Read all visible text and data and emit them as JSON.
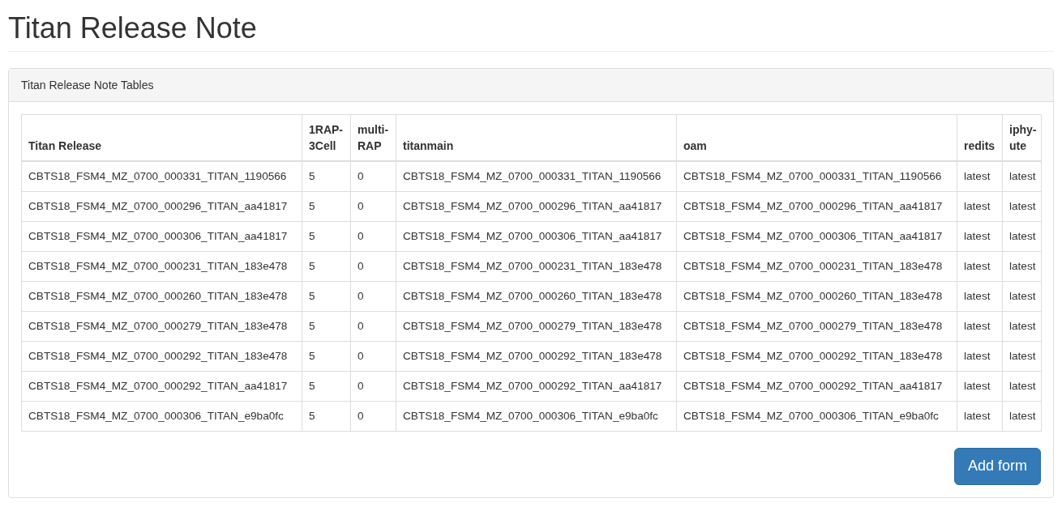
{
  "page_title": "Titan Release Note",
  "panel": {
    "heading": "Titan Release Note Tables",
    "table": {
      "columns": [
        "Titan Release",
        "1RAP-3Cell",
        "multi-RAP",
        "titanmain",
        "oam",
        "redits",
        "iphy-ute"
      ],
      "rows": [
        [
          "CBTS18_FSM4_MZ_0700_000331_TITAN_1190566",
          "5",
          "0",
          "CBTS18_FSM4_MZ_0700_000331_TITAN_1190566",
          "CBTS18_FSM4_MZ_0700_000331_TITAN_1190566",
          "latest",
          "latest"
        ],
        [
          "CBTS18_FSM4_MZ_0700_000296_TITAN_aa41817",
          "5",
          "0",
          "CBTS18_FSM4_MZ_0700_000296_TITAN_aa41817",
          "CBTS18_FSM4_MZ_0700_000296_TITAN_aa41817",
          "latest",
          "latest"
        ],
        [
          "CBTS18_FSM4_MZ_0700_000306_TITAN_aa41817",
          "5",
          "0",
          "CBTS18_FSM4_MZ_0700_000306_TITAN_aa41817",
          "CBTS18_FSM4_MZ_0700_000306_TITAN_aa41817",
          "latest",
          "latest"
        ],
        [
          "CBTS18_FSM4_MZ_0700_000231_TITAN_183e478",
          "5",
          "0",
          "CBTS18_FSM4_MZ_0700_000231_TITAN_183e478",
          "CBTS18_FSM4_MZ_0700_000231_TITAN_183e478",
          "latest",
          "latest"
        ],
        [
          "CBTS18_FSM4_MZ_0700_000260_TITAN_183e478",
          "5",
          "0",
          "CBTS18_FSM4_MZ_0700_000260_TITAN_183e478",
          "CBTS18_FSM4_MZ_0700_000260_TITAN_183e478",
          "latest",
          "latest"
        ],
        [
          "CBTS18_FSM4_MZ_0700_000279_TITAN_183e478",
          "5",
          "0",
          "CBTS18_FSM4_MZ_0700_000279_TITAN_183e478",
          "CBTS18_FSM4_MZ_0700_000279_TITAN_183e478",
          "latest",
          "latest"
        ],
        [
          "CBTS18_FSM4_MZ_0700_000292_TITAN_183e478",
          "5",
          "0",
          "CBTS18_FSM4_MZ_0700_000292_TITAN_183e478",
          "CBTS18_FSM4_MZ_0700_000292_TITAN_183e478",
          "latest",
          "latest"
        ],
        [
          "CBTS18_FSM4_MZ_0700_000292_TITAN_aa41817",
          "5",
          "0",
          "CBTS18_FSM4_MZ_0700_000292_TITAN_aa41817",
          "CBTS18_FSM4_MZ_0700_000292_TITAN_aa41817",
          "latest",
          "latest"
        ],
        [
          "CBTS18_FSM4_MZ_0700_000306_TITAN_e9ba0fc",
          "5",
          "0",
          "CBTS18_FSM4_MZ_0700_000306_TITAN_e9ba0fc",
          "CBTS18_FSM4_MZ_0700_000306_TITAN_e9ba0fc",
          "latest",
          "latest"
        ]
      ]
    },
    "button": "Add form"
  }
}
